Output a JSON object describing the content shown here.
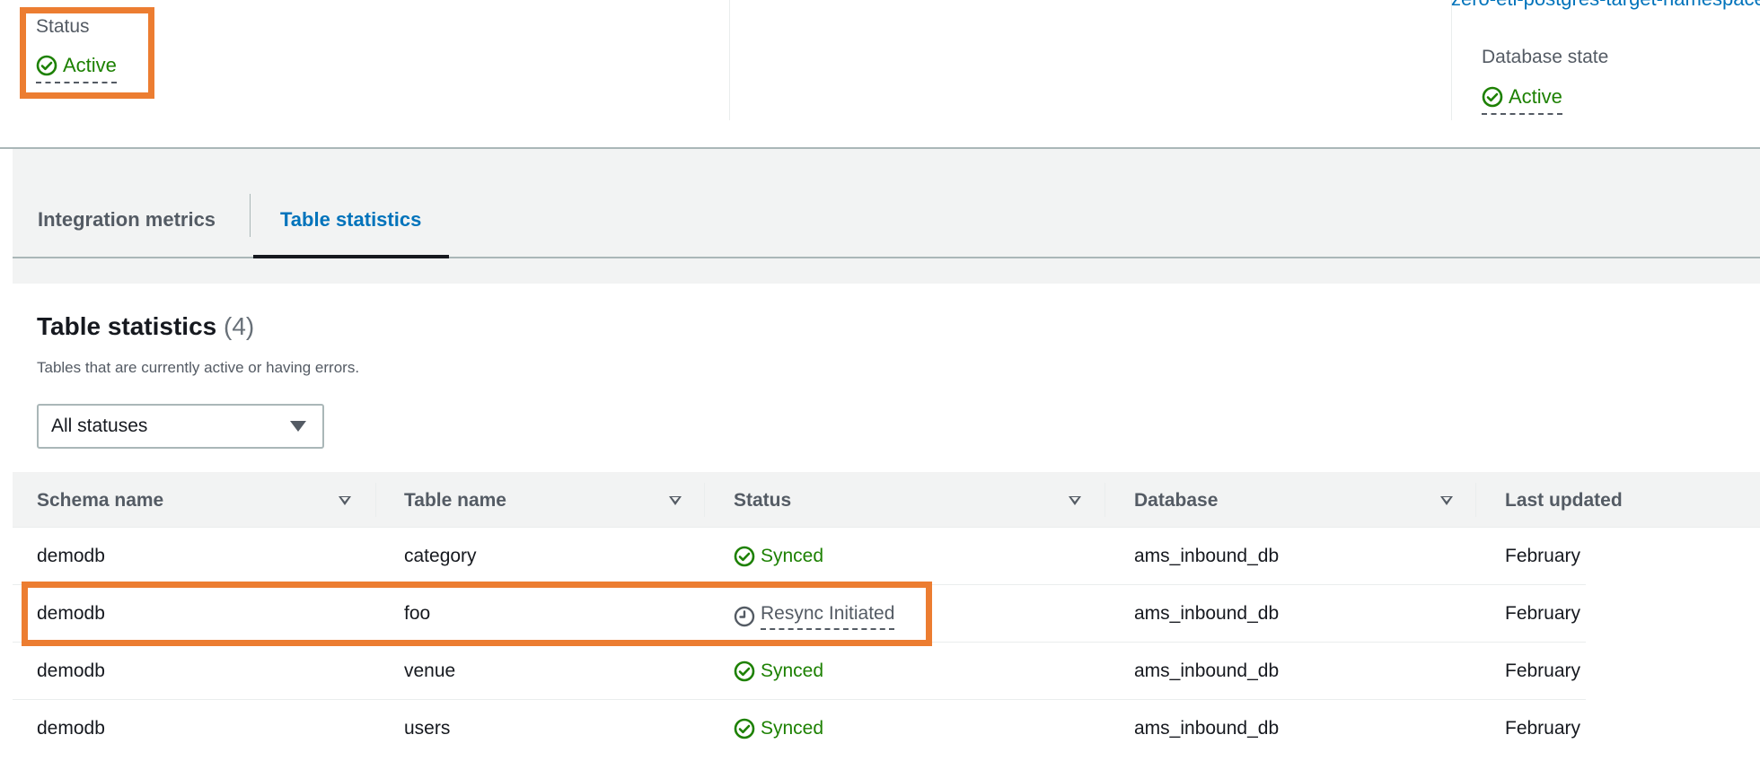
{
  "summary": {
    "status_label": "Status",
    "status_value": "Active",
    "database_state_label": "Database state",
    "database_state_value": "Active",
    "truncated_link": "zero-etl-postgres-target-namespace"
  },
  "tabs": [
    {
      "label": "Integration metrics",
      "active": false
    },
    {
      "label": "Table statistics",
      "active": true
    }
  ],
  "table_stats": {
    "title": "Table statistics",
    "count": "(4)",
    "description": "Tables that are currently active or having errors.",
    "filter_selected": "All statuses",
    "columns": [
      "Schema name",
      "Table name",
      "Status",
      "Database",
      "Last updated"
    ],
    "rows": [
      {
        "schema": "demodb",
        "table": "category",
        "status": "Synced",
        "status_kind": "ok",
        "database": "ams_inbound_db",
        "last_updated": "February"
      },
      {
        "schema": "demodb",
        "table": "foo",
        "status": "Resync Initiated",
        "status_kind": "pending",
        "database": "ams_inbound_db",
        "last_updated": "February"
      },
      {
        "schema": "demodb",
        "table": "venue",
        "status": "Synced",
        "status_kind": "ok",
        "database": "ams_inbound_db",
        "last_updated": "February"
      },
      {
        "schema": "demodb",
        "table": "users",
        "status": "Synced",
        "status_kind": "ok",
        "database": "ams_inbound_db",
        "last_updated": "February"
      }
    ]
  },
  "colors": {
    "success": "#1d8102",
    "link": "#0073bb",
    "highlight": "#ec7d31",
    "muted": "#545b64"
  },
  "icons": {
    "ok": "status-success-icon",
    "pending": "clock-icon",
    "filter_caret": "caret-down-icon",
    "sort": "sort-icon"
  }
}
